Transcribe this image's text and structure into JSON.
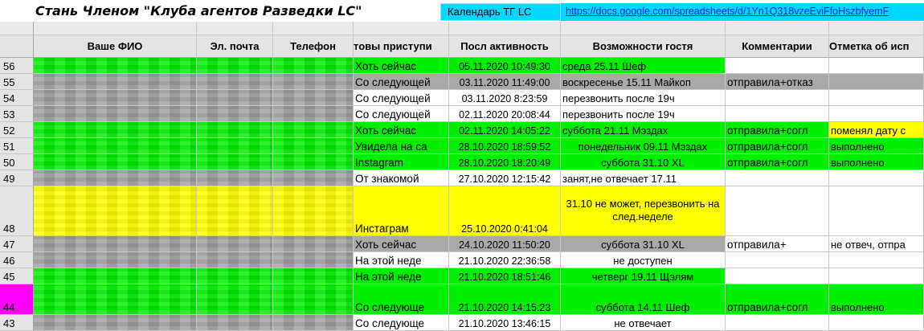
{
  "title": "Стань Членом \"Клуба агентов Разведки LC\"",
  "calendar_label": "Календарь ТГ LC",
  "calendar_link": "https://docs.google.com/spreadsheets/d/1Yn1Q318vzeEviFfoHszbfyemF",
  "headers": {
    "name": "Ваше ФИО",
    "email": "Эл. почта",
    "phone": "Телефон",
    "ready": "товы приступи",
    "activity": "Посл активность",
    "guest": "Возможности гостя",
    "comments": "Комментарии",
    "mark": "Отметка об исп"
  },
  "colors": {
    "green": "#00ee00",
    "gray": "#a9a9a9",
    "yellow": "#ffff00",
    "magenta": "#ff00ff",
    "white": "#ffffff",
    "cyan": "#00d8ff"
  },
  "rows": [
    {
      "num": "56",
      "ready": "Хоть сейчас",
      "activity": "05.11.2020 10:49:30",
      "guest": "среда 25.11 Шеф",
      "comment": "",
      "mark": ""
    },
    {
      "num": "55",
      "ready": "Со следующей",
      "activity": "03.11.2020 11:49:00",
      "guest": "воскресенье 15.11 Майкоп",
      "comment": "отправила+отказ",
      "mark": ""
    },
    {
      "num": "54",
      "ready": "Со следующей",
      "activity": "03.11.2020 8:23:59",
      "guest": "перезвонить после 19ч",
      "comment": "",
      "mark": ""
    },
    {
      "num": "53",
      "ready": "Со следующей",
      "activity": "02.11.2020 20:08:44",
      "guest": "перезвонить после 19ч",
      "comment": "",
      "mark": ""
    },
    {
      "num": "52",
      "ready": "Хоть сейчас",
      "activity": "02.11.2020 14:05:22",
      "guest": "суббота 21.11 Мэздах",
      "comment": "отправила+согл",
      "mark": "поменял дату с"
    },
    {
      "num": "51",
      "ready": "Увидела на са",
      "activity": "28.10.2020 18:59:52",
      "guest": "понедельник 09.11 Мэздах",
      "comment": "отправила+согл",
      "mark": "выполнено"
    },
    {
      "num": "50",
      "ready": "Instagram",
      "activity": "28.10.2020 18:20:49",
      "guest": "суббота 31.10 XL",
      "comment": "отправила+согл",
      "mark": "выполнено"
    },
    {
      "num": "49",
      "ready": "От знакомой",
      "activity": "27.10.2020 12:15:42",
      "guest": "занят,не отвечает 17.11",
      "comment": "",
      "mark": ""
    },
    {
      "num": "48",
      "ready": "Инстаграм",
      "activity": "25.10.2020 0:41:04",
      "guest": "31.10 не может, перезвонить на след.неделе",
      "comment": "",
      "mark": ""
    },
    {
      "num": "47",
      "ready": "Хоть сейчас",
      "activity": "24.10.2020 11:50:20",
      "guest": "суббота 31.10 XL",
      "comment": "отправила+",
      "mark": "не отвеч, отпра"
    },
    {
      "num": "46",
      "ready": "На этой неде",
      "activity": "21.10.2020 22:36:58",
      "guest": "не доступен",
      "comment": "",
      "mark": ""
    },
    {
      "num": "45",
      "ready": "На этой неде",
      "activity": "21.10.2020 18:51:46",
      "guest": "четверг 19.11 Щэлям",
      "comment": "",
      "mark": ""
    },
    {
      "num": "44",
      "ready": "Со следующе",
      "activity": "21.10.2020 14:15:23",
      "guest": "суббота 14.11 Шеф",
      "comment": "отправила+согл",
      "mark": "выполнено"
    },
    {
      "num": "43",
      "ready": "Со следующе",
      "activity": "21.10.2020 13:46:15",
      "guest": "не отвечает",
      "comment": "",
      "mark": ""
    }
  ]
}
